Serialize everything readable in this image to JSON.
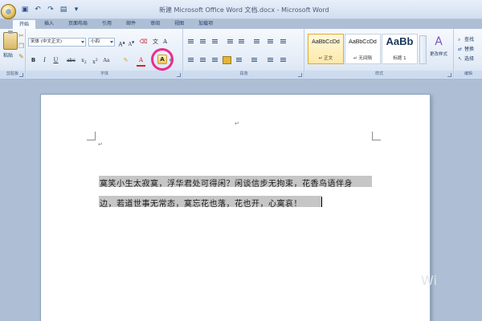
{
  "window": {
    "title": "新建 Microsoft Office Word 文档.docx - Microsoft Word"
  },
  "quick_access": {
    "icons": [
      "save-icon",
      "undo-icon",
      "redo-icon",
      "print-preview-icon",
      "dropdown-icon"
    ]
  },
  "tabs": [
    {
      "label": "开始",
      "active": true
    },
    {
      "label": "插入",
      "active": false
    },
    {
      "label": "页面布局",
      "active": false
    },
    {
      "label": "引用",
      "active": false
    },
    {
      "label": "邮件",
      "active": false
    },
    {
      "label": "审阅",
      "active": false
    },
    {
      "label": "视图",
      "active": false
    },
    {
      "label": "加载项",
      "active": false
    }
  ],
  "ribbon": {
    "clipboard": {
      "paste_label": "粘贴",
      "group_label": "剪贴板"
    },
    "font": {
      "font_name": "宋体 (中文正文)",
      "font_size": "小四",
      "group_label": "字体",
      "highlight_button": "A",
      "font_color": "#d42424",
      "highlight_color": "#f1c453"
    },
    "paragraph": {
      "group_label": "段落"
    },
    "styles": {
      "items": [
        {
          "sample": "AaBbCcDd",
          "name": "↵ 正文",
          "selected": true
        },
        {
          "sample": "AaBbCcDd",
          "name": "↵ 无间隔",
          "selected": false
        },
        {
          "sample": "AaBb",
          "name": "标题 1",
          "selected": false
        }
      ],
      "change_styles_label": "更改样式",
      "group_label": "样式"
    },
    "editing": {
      "find": "查找",
      "replace": "替换",
      "select": "选择",
      "group_label": "编辑"
    }
  },
  "document": {
    "line1": "寞笑小生太寂寞，浮华君处可得闲？闲谈信步无拘束，花香鸟语伴身",
    "line2": "边，若道世事无常态，寞忘花也落，花也开，心寞哀！",
    "paragraph_mark": "↵",
    "selection_color": "#c6c6c6"
  },
  "annotation": {
    "circle_color": "#ea2d8f"
  },
  "watermark": "Wi"
}
